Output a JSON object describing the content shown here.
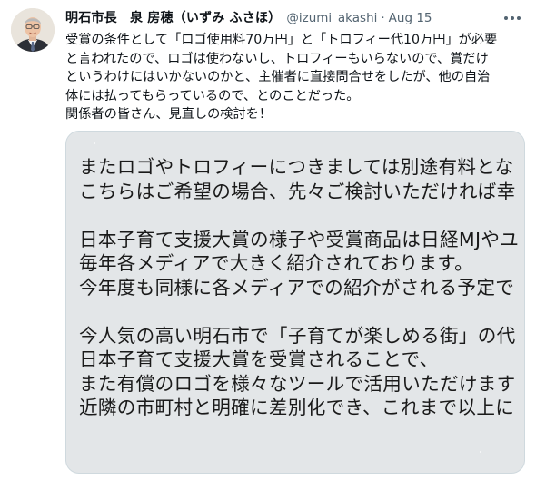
{
  "author": {
    "display_name": "明石市長　泉 房穂（いずみ ふさほ）",
    "handle": "@izumi_akashi",
    "separator": "·",
    "timestamp": "Aug 15"
  },
  "tweet": {
    "lines": [
      "受賞の条件として「ロゴ使用料70万円」と「トロフィー代10万円」が必要",
      "と言われたので、ロゴは使わないし、トロフィーもいらないので、賞だけ",
      "というわけにはいかないのかと、主催者に直接問合せをしたが、他の自治",
      "体には払ってもらっているので、とのことだった。",
      "関係者の皆さん、見直しの検討を！"
    ]
  },
  "media": {
    "lines": [
      "またロゴやトロフィーにつきましては別途有料とな",
      "こちらはご希望の場合、先々ご検討いただければ幸",
      "",
      "日本子育て支援大賞の様子や受賞商品は日経MJやユ",
      "毎年各メディアで大きく紹介されております。",
      "今年度も同様に各メディアでの紹介がされる予定で",
      "",
      "今人気の高い明石市で「子育てが楽しめる街」の代",
      "日本子育て支援大賞を受賞されることで、",
      "また有償のロゴを様々なツールで活用いただけます",
      "近隣の市町村と明確に差別化でき、これまで以上に"
    ]
  },
  "icons": {
    "more": "more-horizontal-icon",
    "avatar": "avatar-portrait"
  },
  "colors": {
    "text": "#0f1419",
    "secondary": "#536471",
    "media_bg": "#e3e6e8",
    "border": "#cfd9de"
  }
}
